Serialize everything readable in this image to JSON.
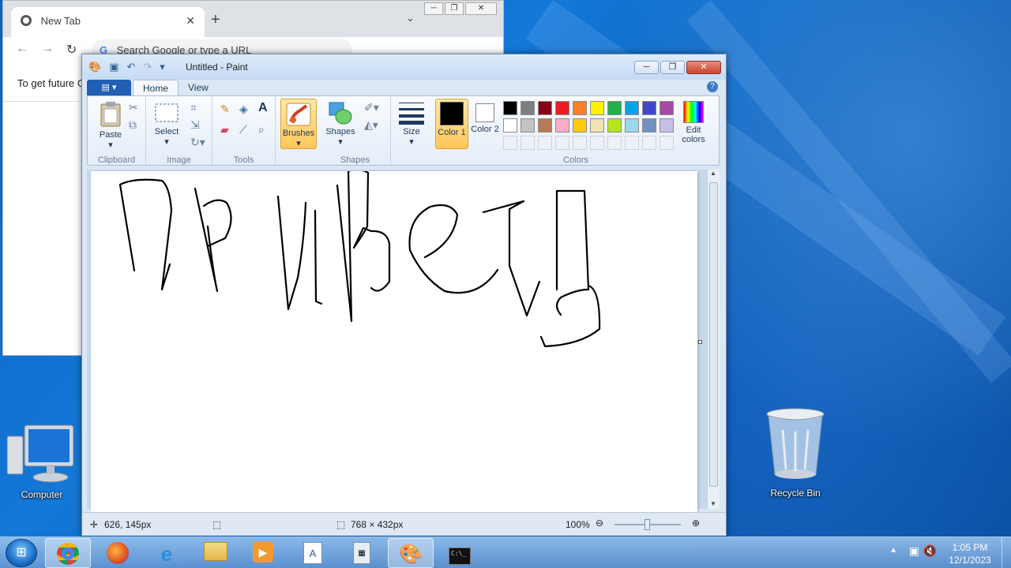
{
  "desktop": {
    "icons": [
      {
        "label": "Computer",
        "icon": "computer-icon"
      },
      {
        "label": "Recycle Bin",
        "icon": "recycle-bin-icon"
      }
    ]
  },
  "chrome": {
    "tab_title": "New Tab",
    "omnibox_placeholder": "Search Google or type a URL",
    "infobar_text": "To get future G"
  },
  "paint": {
    "title": "Untitled - Paint",
    "tabs": [
      "Home",
      "View"
    ],
    "groups": {
      "clipboard": {
        "label": "Clipboard",
        "paste": "Paste"
      },
      "image": {
        "label": "Image",
        "select": "Select"
      },
      "tools": {
        "label": "Tools"
      },
      "brushes": {
        "label": "Brushes"
      },
      "shapes": {
        "label": "Shapes",
        "button": "Shapes"
      },
      "size": {
        "label": "Size"
      },
      "colors": {
        "label": "Colors",
        "color1": "Color 1",
        "color2": "Color 2",
        "edit": "Edit colors",
        "color1_value": "#000000",
        "color2_value": "#ffffff",
        "palette_row1": [
          "#000000",
          "#7f7f7f",
          "#880015",
          "#ed1c24",
          "#ff7f27",
          "#fff200",
          "#22b14c",
          "#00a2e8",
          "#3f48cc",
          "#a349a4"
        ],
        "palette_row2": [
          "#ffffff",
          "#c3c3c3",
          "#b97a57",
          "#ffaec9",
          "#ffc90e",
          "#efe4b0",
          "#b5e61d",
          "#99d9ea",
          "#7092be",
          "#c8bfe7"
        ]
      }
    },
    "status": {
      "cursor_pos": "626, 145px",
      "image_size": "768 × 432px",
      "zoom": "100%"
    }
  },
  "taskbar": {
    "time": "1:05 PM",
    "date": "12/1/2023"
  }
}
